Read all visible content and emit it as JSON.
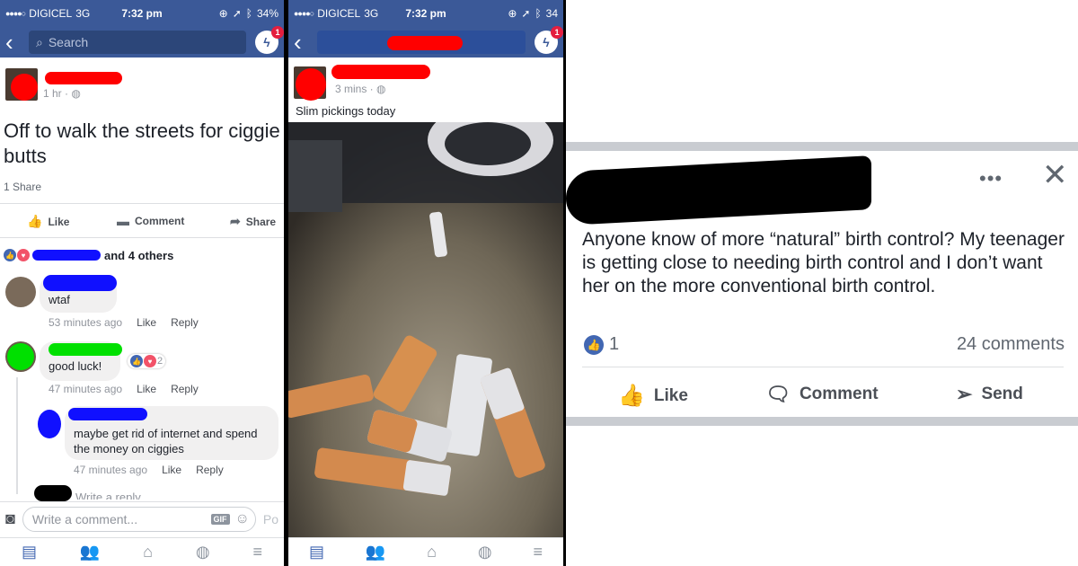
{
  "panel1": {
    "status": {
      "carrier": "DIGICEL",
      "network": "3G",
      "time": "7:32 pm",
      "battery": "34%"
    },
    "nav": {
      "search_placeholder": "Search",
      "badge": "1"
    },
    "post": {
      "time": "1 hr",
      "text": "Off to walk the streets for ciggie butts",
      "shares": "1 Share",
      "actions": {
        "like": "Like",
        "comment": "Comment",
        "share": "Share"
      },
      "reactions_others": "and 4 others"
    },
    "comments": [
      {
        "text": "wtaf",
        "time": "53 minutes ago",
        "like": "Like",
        "reply": "Reply"
      },
      {
        "text": "good luck!",
        "time": "47 minutes ago",
        "like": "Like",
        "reply": "Reply",
        "reaction_count": "2"
      },
      {
        "text": "maybe get rid of internet and spend the money on ciggies",
        "time": "47 minutes ago",
        "like": "Like",
        "reply": "Reply"
      }
    ],
    "reply_placeholder": "Write a reply...",
    "composer": {
      "placeholder": "Write a comment...",
      "gif": "GIF",
      "post": "Po"
    }
  },
  "panel2": {
    "status": {
      "carrier": "DIGICEL",
      "network": "3G",
      "time": "7:32 pm",
      "battery": "34"
    },
    "nav": {
      "badge": "1"
    },
    "post": {
      "time": "3 mins",
      "text": "Slim pickings today"
    }
  },
  "panel3": {
    "text": "Anyone know of more “natural” birth control? My teenager is getting close to needing birth control and I don’t want her on the more conventional birth control.",
    "like_count": "1",
    "comments_count": "24 comments",
    "actions": {
      "like": "Like",
      "comment": "Comment",
      "send": "Send"
    }
  },
  "colors": {
    "facebook_blue": "#3b5998",
    "redaction_red": "#ff0000",
    "redaction_blue": "#1010ff",
    "redaction_green": "#00e000",
    "redaction_black": "#000000"
  }
}
